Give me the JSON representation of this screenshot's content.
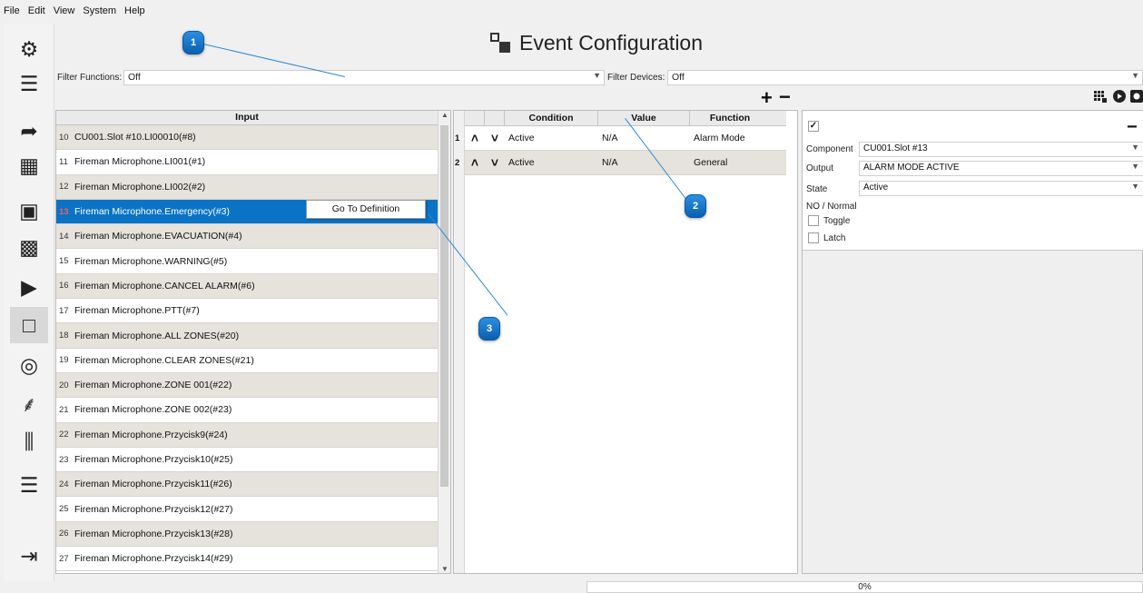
{
  "menu": [
    "File",
    "Edit",
    "View",
    "System",
    "Help"
  ],
  "title": "Event Configuration",
  "sidebar": [
    {
      "icon": "gear-icon",
      "glyph": "⚙"
    },
    {
      "icon": "device-icon",
      "glyph": "☰"
    },
    {
      "icon": "route-icon",
      "glyph": "➦"
    },
    {
      "icon": "speaker-grid-icon",
      "glyph": "▦"
    },
    {
      "icon": "io-icon",
      "glyph": "▣"
    },
    {
      "icon": "matrix-icon",
      "glyph": "▩"
    },
    {
      "icon": "playlist-icon",
      "glyph": "▶"
    },
    {
      "icon": "event-config-icon",
      "glyph": "□"
    },
    {
      "icon": "monitor-icon",
      "glyph": "◎"
    },
    {
      "icon": "microphone-icon",
      "glyph": "⸙"
    },
    {
      "icon": "mixer-icon",
      "glyph": "⫼"
    },
    {
      "icon": "document-icon",
      "glyph": "☰"
    },
    {
      "icon": "logout-icon",
      "glyph": "⇥"
    }
  ],
  "filters": {
    "functions_label": "Filter Functions:",
    "functions_value": "Off",
    "devices_label": "Filter Devices:",
    "devices_value": "Off"
  },
  "toolbar": {
    "add": "+",
    "remove": "−",
    "right_remove": "−"
  },
  "input_table": {
    "header": "Input",
    "rows": [
      {
        "num": "10",
        "text": "CU001.Slot #10.LI00010(#8)"
      },
      {
        "num": "11",
        "text": "Fireman Microphone.LI001(#1)"
      },
      {
        "num": "12",
        "text": "Fireman Microphone.LI002(#2)"
      },
      {
        "num": "13",
        "text": "Fireman Microphone.Emergency(#3)",
        "selected": true
      },
      {
        "num": "14",
        "text": "Fireman Microphone.EVACUATION(#4)"
      },
      {
        "num": "15",
        "text": "Fireman Microphone.WARNING(#5)"
      },
      {
        "num": "16",
        "text": "Fireman Microphone.CANCEL ALARM(#6)"
      },
      {
        "num": "17",
        "text": "Fireman Microphone.PTT(#7)"
      },
      {
        "num": "18",
        "text": "Fireman Microphone.ALL ZONES(#20)"
      },
      {
        "num": "19",
        "text": "Fireman Microphone.CLEAR ZONES(#21)"
      },
      {
        "num": "20",
        "text": "Fireman Microphone.ZONE 001(#22)"
      },
      {
        "num": "21",
        "text": "Fireman Microphone.ZONE 002(#23)"
      },
      {
        "num": "22",
        "text": "Fireman Microphone.Przycisk9(#24)"
      },
      {
        "num": "23",
        "text": "Fireman Microphone.Przycisk10(#25)"
      },
      {
        "num": "24",
        "text": "Fireman Microphone.Przycisk11(#26)"
      },
      {
        "num": "25",
        "text": "Fireman Microphone.Przycisk12(#27)"
      },
      {
        "num": "26",
        "text": "Fireman Microphone.Przycisk13(#28)"
      },
      {
        "num": "27",
        "text": "Fireman Microphone.Przycisk14(#29)"
      }
    ]
  },
  "context_menu": {
    "item": "Go To Definition"
  },
  "event_table": {
    "headers": [
      "",
      "",
      "Condition",
      "Value",
      "Function"
    ],
    "rows": [
      {
        "num": "1",
        "condition": "Active",
        "value": "N/A",
        "function": "Alarm Mode"
      },
      {
        "num": "2",
        "condition": "Active",
        "value": "N/A",
        "function": "General"
      }
    ]
  },
  "details": {
    "enabled_check": "✓",
    "component_label": "Component",
    "component_value": "CU001.Slot #13",
    "output_label": "Output",
    "output_value": "ALARM MODE ACTIVE",
    "state_label": "State",
    "state_value": "Active",
    "mode_label": "NO / Normal",
    "toggle_label": "Toggle",
    "latch_label": "Latch"
  },
  "progress": {
    "text": "0%",
    "value": 0
  },
  "callouts": [
    "1",
    "2",
    "3"
  ],
  "colors": {
    "selection": "#0a73c6",
    "badge": "#1c7ad0",
    "alt_row": "#e6e2dc"
  }
}
